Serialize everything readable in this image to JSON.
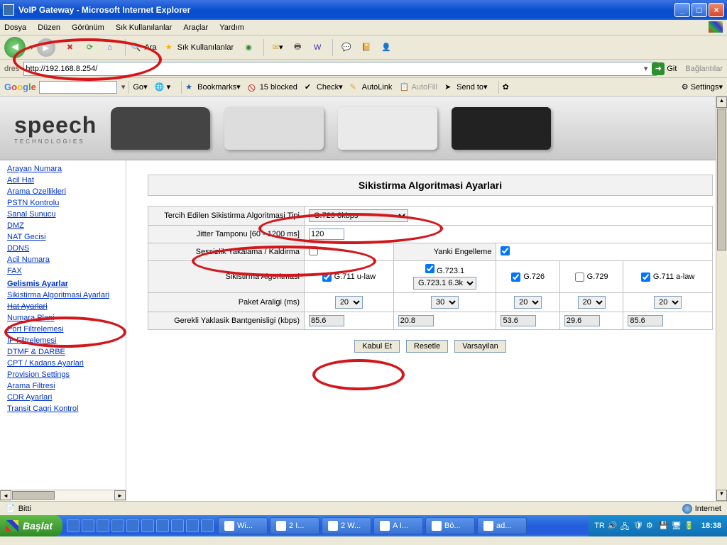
{
  "window": {
    "title": "VoIP Gateway - Microsoft Internet Explorer"
  },
  "menu": {
    "dosya": "Dosya",
    "duzen": "Düzen",
    "gorunum": "Görünüm",
    "sik": "Sık Kullanılanlar",
    "araclar": "Araçlar",
    "yardim": "Yardım"
  },
  "toolbar": {
    "ara": "Ara",
    "sik": "Sık Kullanılanlar"
  },
  "address": {
    "label": "dres",
    "url": "http://192.168.8.254/",
    "go": "Git",
    "links": "Bağlantılar"
  },
  "google": {
    "brand": "Google",
    "go": "Go",
    "bookmarks": "Bookmarks",
    "blocked": "15 blocked",
    "check": "Check",
    "autolink": "AutoLink",
    "autofill": "AutoFill",
    "sendto": "Send to",
    "settings": "Settings"
  },
  "logo": {
    "brand": "speech",
    "sub": "TECHNOLOGIES"
  },
  "sidebar": {
    "items": [
      "Arayan Numara",
      "Acil Hat",
      "Arama Ozellikleri",
      "PSTN Kontrolu",
      "Sanal Sunucu",
      "DMZ",
      "NAT Gecisi",
      "DDNS",
      "Acil Numara",
      "FAX"
    ],
    "section": "Gelismis Ayarlar",
    "items2": [
      "Sikistirma Algoritmasi Ayarlari",
      "Hat Ayarlari",
      "Numara Plani",
      "Port Filtrelemesi",
      "IP Filtrelemesi",
      "DTMF & DARBE",
      "CPT / Kadans Ayarlari",
      "Provision Settings",
      "Arama Filtresi",
      "CDR Ayarlari",
      "Transit Cagri Kontrol"
    ]
  },
  "panel": {
    "title": "Sikistirma Algoritmasi Ayarlari",
    "row_codec_type": "Tercih Edilen Sikistirma Algoritmasi Tipi",
    "codec_type_value": "G.729 8kbps",
    "row_jitter": "Jitter Tamponu [60 - 1200 ms]",
    "jitter_value": "120",
    "row_silence": "Sessizlik Yakalama / Kaldirma",
    "row_echo": "Yanki Engelleme",
    "row_codec": "Sikistirma Algoritmasi",
    "codec1": "G.711 u-law",
    "codec2": "G.723.1",
    "codec2_sel": "G.723.1 6.3k",
    "codec3": "G.726",
    "codec4": "G.729",
    "codec5": "G.711 a-law",
    "row_packet": "Paket Araligi (ms)",
    "p1": "20",
    "p2": "30",
    "p3": "20",
    "p4": "20",
    "p5": "20",
    "row_bw": "Gerekli Yaklasik Bantgenisligi (kbps)",
    "bw1": "85.6",
    "bw2": "20.8",
    "bw3": "53.6",
    "bw4": "29.6",
    "bw5": "85.6",
    "btn_ok": "Kabul Et",
    "btn_reset": "Resetle",
    "btn_default": "Varsayilan"
  },
  "status": {
    "done": "Bitti",
    "zone": "Internet"
  },
  "taskbar": {
    "start": "Başlat",
    "tasks": [
      "Wi...",
      "2 I...",
      "2 W...",
      "A I...",
      "Bö...",
      "ad..."
    ],
    "lang": "TR",
    "clock": "18:38"
  }
}
